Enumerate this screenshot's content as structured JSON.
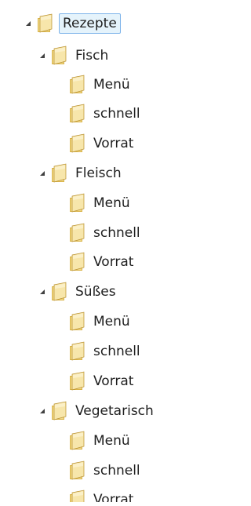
{
  "tree": {
    "root": {
      "label": "Rezepte",
      "expander_icon": "expanded-triangle-icon",
      "folder_icon": "folder-icon",
      "selected": true
    },
    "groups": [
      {
        "label": "Fisch",
        "expanded": true,
        "children": [
          "Menü",
          "schnell",
          "Vorrat"
        ]
      },
      {
        "label": "Fleisch",
        "expanded": true,
        "children": [
          "Menü",
          "schnell",
          "Vorrat"
        ]
      },
      {
        "label": "Süßes",
        "expanded": true,
        "children": [
          "Menü",
          "schnell",
          "Vorrat"
        ]
      },
      {
        "label": "Vegetarisch",
        "expanded": true,
        "children": [
          "Menü",
          "schnell",
          "Vorrat"
        ]
      }
    ]
  },
  "colors": {
    "folder_light": "#f4e09b",
    "folder_dark": "#d9b44a",
    "folder_edge": "#b88f2e",
    "selection_fill": "#e5f3fb",
    "selection_border": "#7eb4ea",
    "text": "#1e1e1e",
    "expander": "#404040"
  }
}
